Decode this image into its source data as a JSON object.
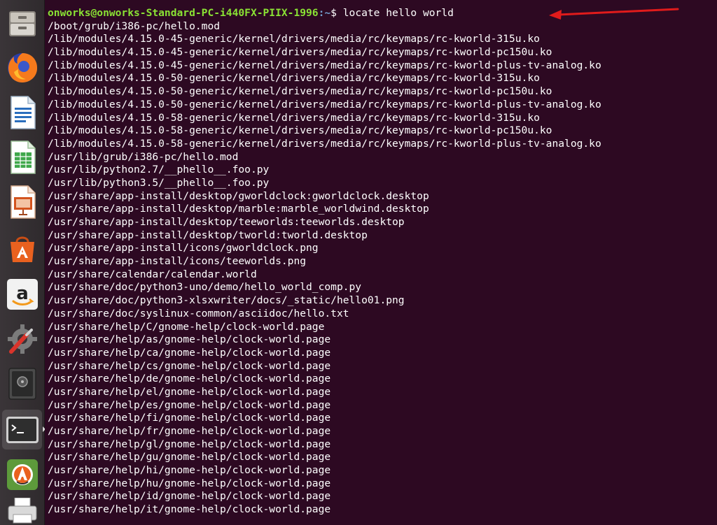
{
  "launcher": {
    "items": [
      {
        "name": "files-icon"
      },
      {
        "name": "firefox-icon"
      },
      {
        "name": "libreoffice-writer-icon"
      },
      {
        "name": "libreoffice-calc-icon"
      },
      {
        "name": "libreoffice-impress-icon"
      },
      {
        "name": "software-center-icon"
      },
      {
        "name": "amazon-icon",
        "glyph": "a"
      },
      {
        "name": "system-settings-icon"
      },
      {
        "name": "safe-icon"
      },
      {
        "name": "terminal-icon",
        "glyph": ">_"
      },
      {
        "name": "software-updater-icon"
      },
      {
        "name": "printer-icon"
      }
    ]
  },
  "terminal": {
    "prompt": {
      "user_host": "onworks@onworks-Standard-PC-i440FX-PIIX-1996",
      "path": ":~",
      "symbol": "$ ",
      "command": "locate hello world"
    },
    "output": [
      "/boot/grub/i386-pc/hello.mod",
      "/lib/modules/4.15.0-45-generic/kernel/drivers/media/rc/keymaps/rc-kworld-315u.ko",
      "/lib/modules/4.15.0-45-generic/kernel/drivers/media/rc/keymaps/rc-kworld-pc150u.ko",
      "/lib/modules/4.15.0-45-generic/kernel/drivers/media/rc/keymaps/rc-kworld-plus-tv-analog.ko",
      "/lib/modules/4.15.0-50-generic/kernel/drivers/media/rc/keymaps/rc-kworld-315u.ko",
      "/lib/modules/4.15.0-50-generic/kernel/drivers/media/rc/keymaps/rc-kworld-pc150u.ko",
      "/lib/modules/4.15.0-50-generic/kernel/drivers/media/rc/keymaps/rc-kworld-plus-tv-analog.ko",
      "/lib/modules/4.15.0-58-generic/kernel/drivers/media/rc/keymaps/rc-kworld-315u.ko",
      "/lib/modules/4.15.0-58-generic/kernel/drivers/media/rc/keymaps/rc-kworld-pc150u.ko",
      "/lib/modules/4.15.0-58-generic/kernel/drivers/media/rc/keymaps/rc-kworld-plus-tv-analog.ko",
      "/usr/lib/grub/i386-pc/hello.mod",
      "/usr/lib/python2.7/__phello__.foo.py",
      "/usr/lib/python3.5/__phello__.foo.py",
      "/usr/share/app-install/desktop/gworldclock:gworldclock.desktop",
      "/usr/share/app-install/desktop/marble:marble_worldwind.desktop",
      "/usr/share/app-install/desktop/teeworlds:teeworlds.desktop",
      "/usr/share/app-install/desktop/tworld:tworld.desktop",
      "/usr/share/app-install/icons/gworldclock.png",
      "/usr/share/app-install/icons/teeworlds.png",
      "/usr/share/calendar/calendar.world",
      "/usr/share/doc/python3-uno/demo/hello_world_comp.py",
      "/usr/share/doc/python3-xlsxwriter/docs/_static/hello01.png",
      "/usr/share/doc/syslinux-common/asciidoc/hello.txt",
      "/usr/share/help/C/gnome-help/clock-world.page",
      "/usr/share/help/as/gnome-help/clock-world.page",
      "/usr/share/help/ca/gnome-help/clock-world.page",
      "/usr/share/help/cs/gnome-help/clock-world.page",
      "/usr/share/help/de/gnome-help/clock-world.page",
      "/usr/share/help/el/gnome-help/clock-world.page",
      "/usr/share/help/es/gnome-help/clock-world.page",
      "/usr/share/help/fi/gnome-help/clock-world.page",
      "/usr/share/help/fr/gnome-help/clock-world.page",
      "/usr/share/help/gl/gnome-help/clock-world.page",
      "/usr/share/help/gu/gnome-help/clock-world.page",
      "/usr/share/help/hi/gnome-help/clock-world.page",
      "/usr/share/help/hu/gnome-help/clock-world.page",
      "/usr/share/help/id/gnome-help/clock-world.page",
      "/usr/share/help/it/gnome-help/clock-world.page"
    ]
  },
  "colors": {
    "terminal_bg": "#2d0922",
    "prompt_user": "#8ae234",
    "prompt_path": "#729fcf",
    "text": "#ffffff",
    "annotation_arrow": "#e01b1b"
  }
}
